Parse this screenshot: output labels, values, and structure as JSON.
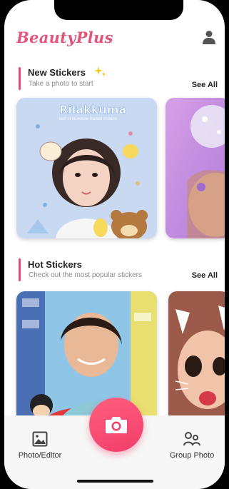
{
  "header": {
    "logo": "BeautyPlus"
  },
  "sections": [
    {
      "title": "New Stickers",
      "subtitle": "Take a photo to start",
      "see_all": "See All",
      "cards": [
        {
          "overlay_text": "Rilakkuma",
          "overlay_subtext": "BEST OF RILAKKUMA FRIENDS STICKERS"
        }
      ]
    },
    {
      "title": "Hot Stickers",
      "subtitle": "Check out the most popular stickers",
      "see_all": "See All"
    }
  ],
  "bottom_nav": {
    "photo_editor": "Photo/Editor",
    "group_photo": "Group Photo"
  },
  "colors": {
    "accent": "#ea4a76",
    "logo": "#e4557a",
    "camera": "#f23d6a"
  },
  "icons": {
    "profile": "person-icon",
    "photo_editor": "image-icon",
    "group_photo": "group-icon",
    "camera": "camera-icon",
    "sparkle": "sparkle-icon"
  }
}
